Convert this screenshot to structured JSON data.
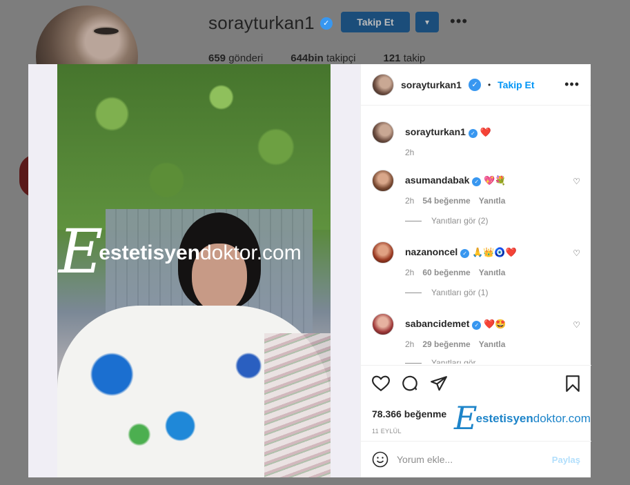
{
  "background": {
    "username": "sorayturkan1",
    "follow_button": "Takip Et",
    "dropdown_icon": "chevron-down-icon",
    "more": "•••",
    "stats": [
      {
        "value": "659",
        "label": "gönderi"
      },
      {
        "value": "644bin",
        "label": "takipçi"
      },
      {
        "value": "121",
        "label": "takip"
      }
    ]
  },
  "watermark": {
    "letter": "E",
    "part1": "estetisyen",
    "part2": "doktor.com"
  },
  "post": {
    "header": {
      "username": "sorayturkan1",
      "separator": "•",
      "follow": "Takip Et",
      "more": "•••"
    },
    "caption": {
      "username": "sorayturkan1",
      "emoji": "❤️",
      "time": "2h"
    },
    "comments": [
      {
        "username": "asumandabak",
        "emoji": "💖💐",
        "time": "2h",
        "likes": "54 beğenme",
        "reply": "Yanıtla",
        "view_replies": "Yanıtları gör (2)"
      },
      {
        "username": "nazanoncel",
        "emoji": "🙏👑🧿❤️",
        "time": "2h",
        "likes": "60 beğenme",
        "reply": "Yanıtla",
        "view_replies": "Yanıtları gör (1)"
      },
      {
        "username": "sabancidemet",
        "emoji": "❤️🤩",
        "time": "2h",
        "likes": "29 beğenme",
        "reply": "Yanıtla",
        "view_replies": "Yanıtları gör"
      }
    ],
    "likes": "78.366 beğenme",
    "date": "11 EYLÜL",
    "comment_placeholder": "Yorum ekle...",
    "post_button": "Paylaş"
  },
  "colors": {
    "accent": "#0095f6",
    "verified": "#3897f0",
    "watermark_blue": "#1d84c9"
  }
}
